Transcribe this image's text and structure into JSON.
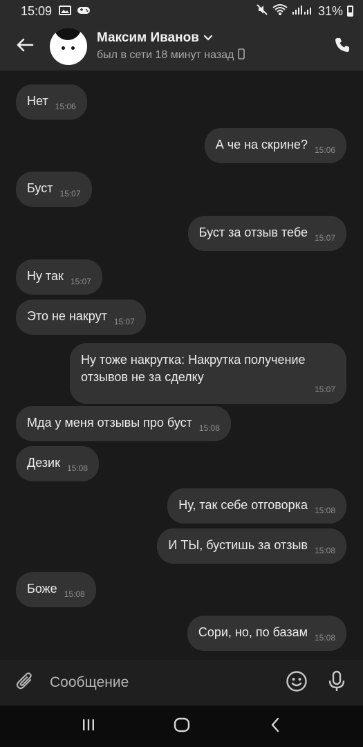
{
  "status_bar": {
    "time": "15:09",
    "battery": "31%"
  },
  "header": {
    "name": "Максим Иванов",
    "status": "был в сети 18 минут назад"
  },
  "messages": [
    {
      "side": "in",
      "text": "Нет",
      "time": "15:06"
    },
    {
      "side": "out",
      "text": "А че на скрине?",
      "time": "15:06"
    },
    {
      "side": "in",
      "text": "Буст",
      "time": "15:07"
    },
    {
      "side": "out",
      "text": "Буст за отзыв тебе",
      "time": "15:07"
    },
    {
      "side": "in",
      "text": "Ну так",
      "time": "15:07"
    },
    {
      "side": "in",
      "text": "Это не накрут",
      "time": "15:07"
    },
    {
      "side": "out",
      "text": "Ну тоже накрутка: Накрутка получение отзывов не за сделку",
      "time": "15:07"
    },
    {
      "side": "in",
      "text": "Мда у меня отзывы про буст",
      "time": "15:08"
    },
    {
      "side": "in",
      "text": "Дезик",
      "time": "15:08"
    },
    {
      "side": "out",
      "text": "Ну, так себе отговорка",
      "time": "15:08"
    },
    {
      "side": "out",
      "text": "И ТЫ, бустишь за отзыв",
      "time": "15:08"
    },
    {
      "side": "in",
      "text": "Боже",
      "time": "15:08"
    },
    {
      "side": "out",
      "text": "Сори, но, по базам",
      "time": "15:08"
    }
  ],
  "composer": {
    "placeholder": "Сообщение"
  },
  "icons": {
    "back": "arrow-left-icon",
    "phone": "phone-icon",
    "attach": "paperclip-icon",
    "emoji": "smiley-icon",
    "mic": "microphone-icon"
  },
  "colors": {
    "background": "#1a1a1a",
    "bubble": "#333333",
    "header": "#2b2b2b"
  }
}
